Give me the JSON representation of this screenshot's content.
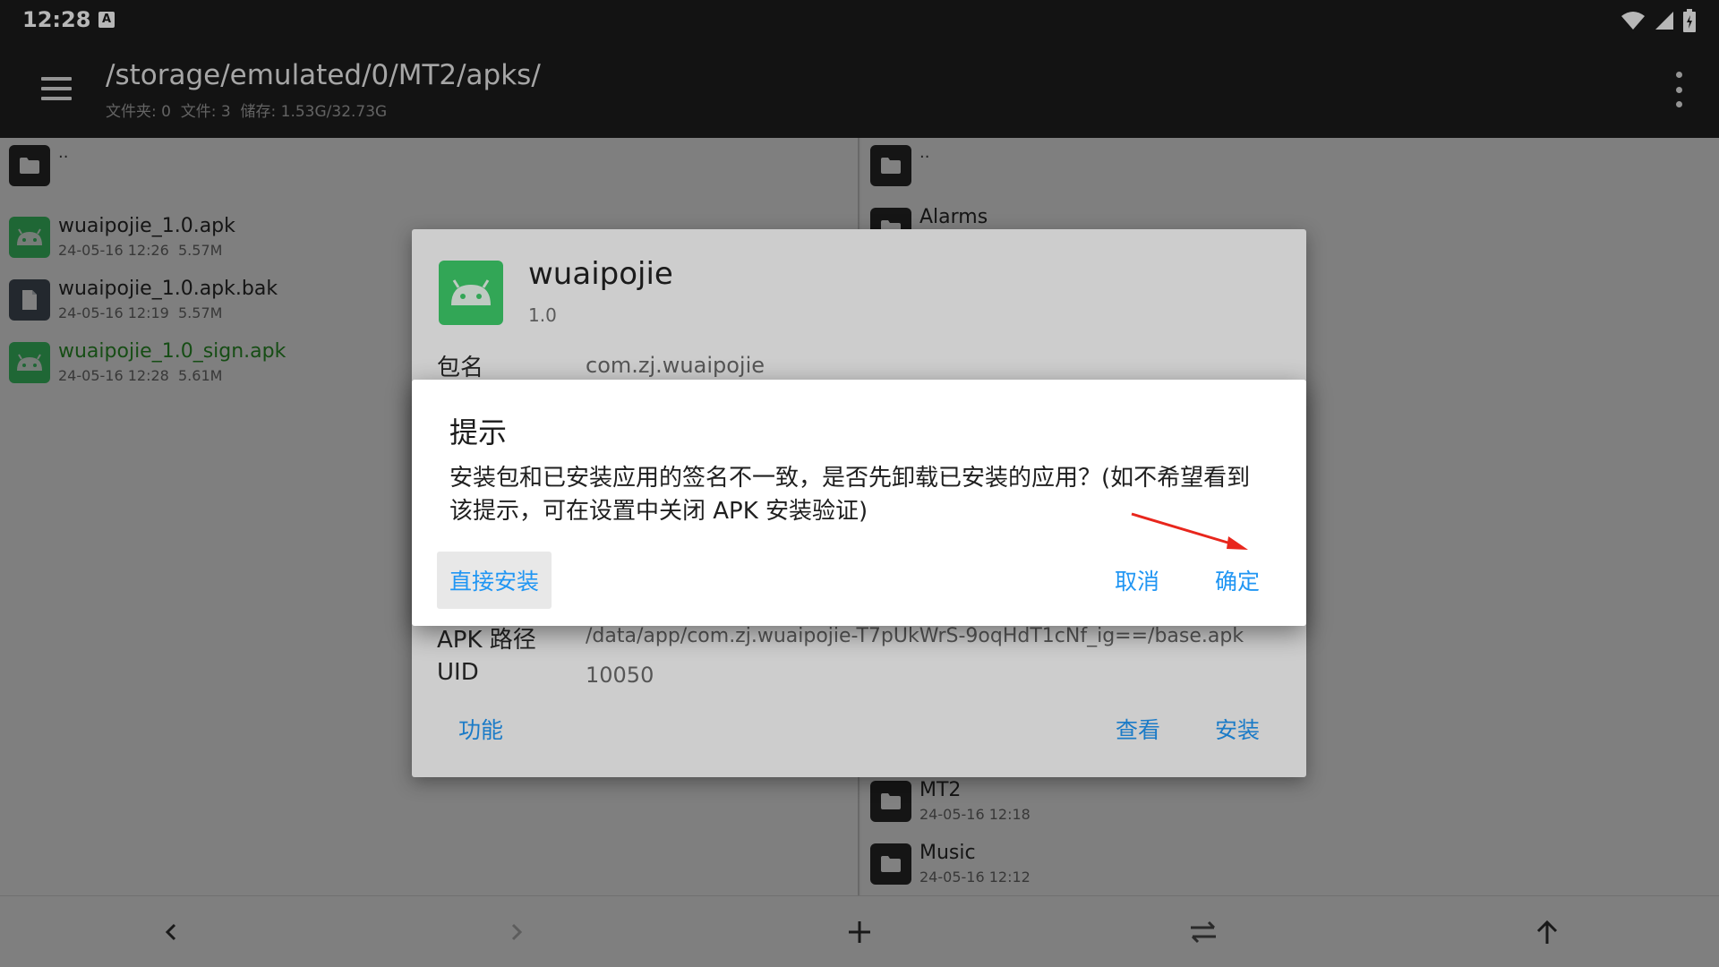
{
  "status_bar": {
    "time": "12:28",
    "keyboard_badge": "A"
  },
  "toolbar": {
    "path": "/storage/emulated/0/MT2/apks/",
    "summary": "文件夹: 0  文件: 3  储存: 1.53G/32.73G"
  },
  "left_pane": {
    "parent": "..",
    "files": [
      {
        "name": "wuaipojie_1.0.apk",
        "meta": "24-05-16 12:26  5.57M",
        "icon": "android-icon",
        "highlight": false
      },
      {
        "name": "wuaipojie_1.0.apk.bak",
        "meta": "24-05-16 12:19  5.57M",
        "icon": "file-icon",
        "highlight": false
      },
      {
        "name": "wuaipojie_1.0_sign.apk",
        "meta": "24-05-16 12:28  5.61M",
        "icon": "android-icon",
        "highlight": true
      }
    ]
  },
  "right_pane": {
    "parent": "..",
    "folders": [
      {
        "name": "Alarms",
        "meta": ""
      },
      {
        "name": "MT2",
        "meta": "24-05-16 12:18"
      },
      {
        "name": "Music",
        "meta": "24-05-16 12:12"
      }
    ]
  },
  "info_dialog": {
    "app_name": "wuaipojie",
    "version": "1.0",
    "package_label": "包名",
    "package_value": "com.zj.wuaipojie",
    "apk_path_label": "APK 路径",
    "apk_path_value": "/data/app/com.zj.wuaipojie-T7pUkWrS-9oqHdT1cNf_ig==/base.apk",
    "uid_label": "UID",
    "uid_value": "10050",
    "btn_function": "功能",
    "btn_view": "查看",
    "btn_install": "安装"
  },
  "alert_dialog": {
    "title": "提示",
    "message": "安装包和已安装应用的签名不一致，是否先卸载已安装的应用？(如不希望看到该提示，可在设置中关闭 APK 安装验证)",
    "btn_direct_install": "直接安装",
    "btn_cancel": "取消",
    "btn_ok": "确定"
  },
  "colors": {
    "accent": "#2196f3",
    "highlight_green": "#2e9a2a",
    "arrow_red": "#e8261c"
  }
}
